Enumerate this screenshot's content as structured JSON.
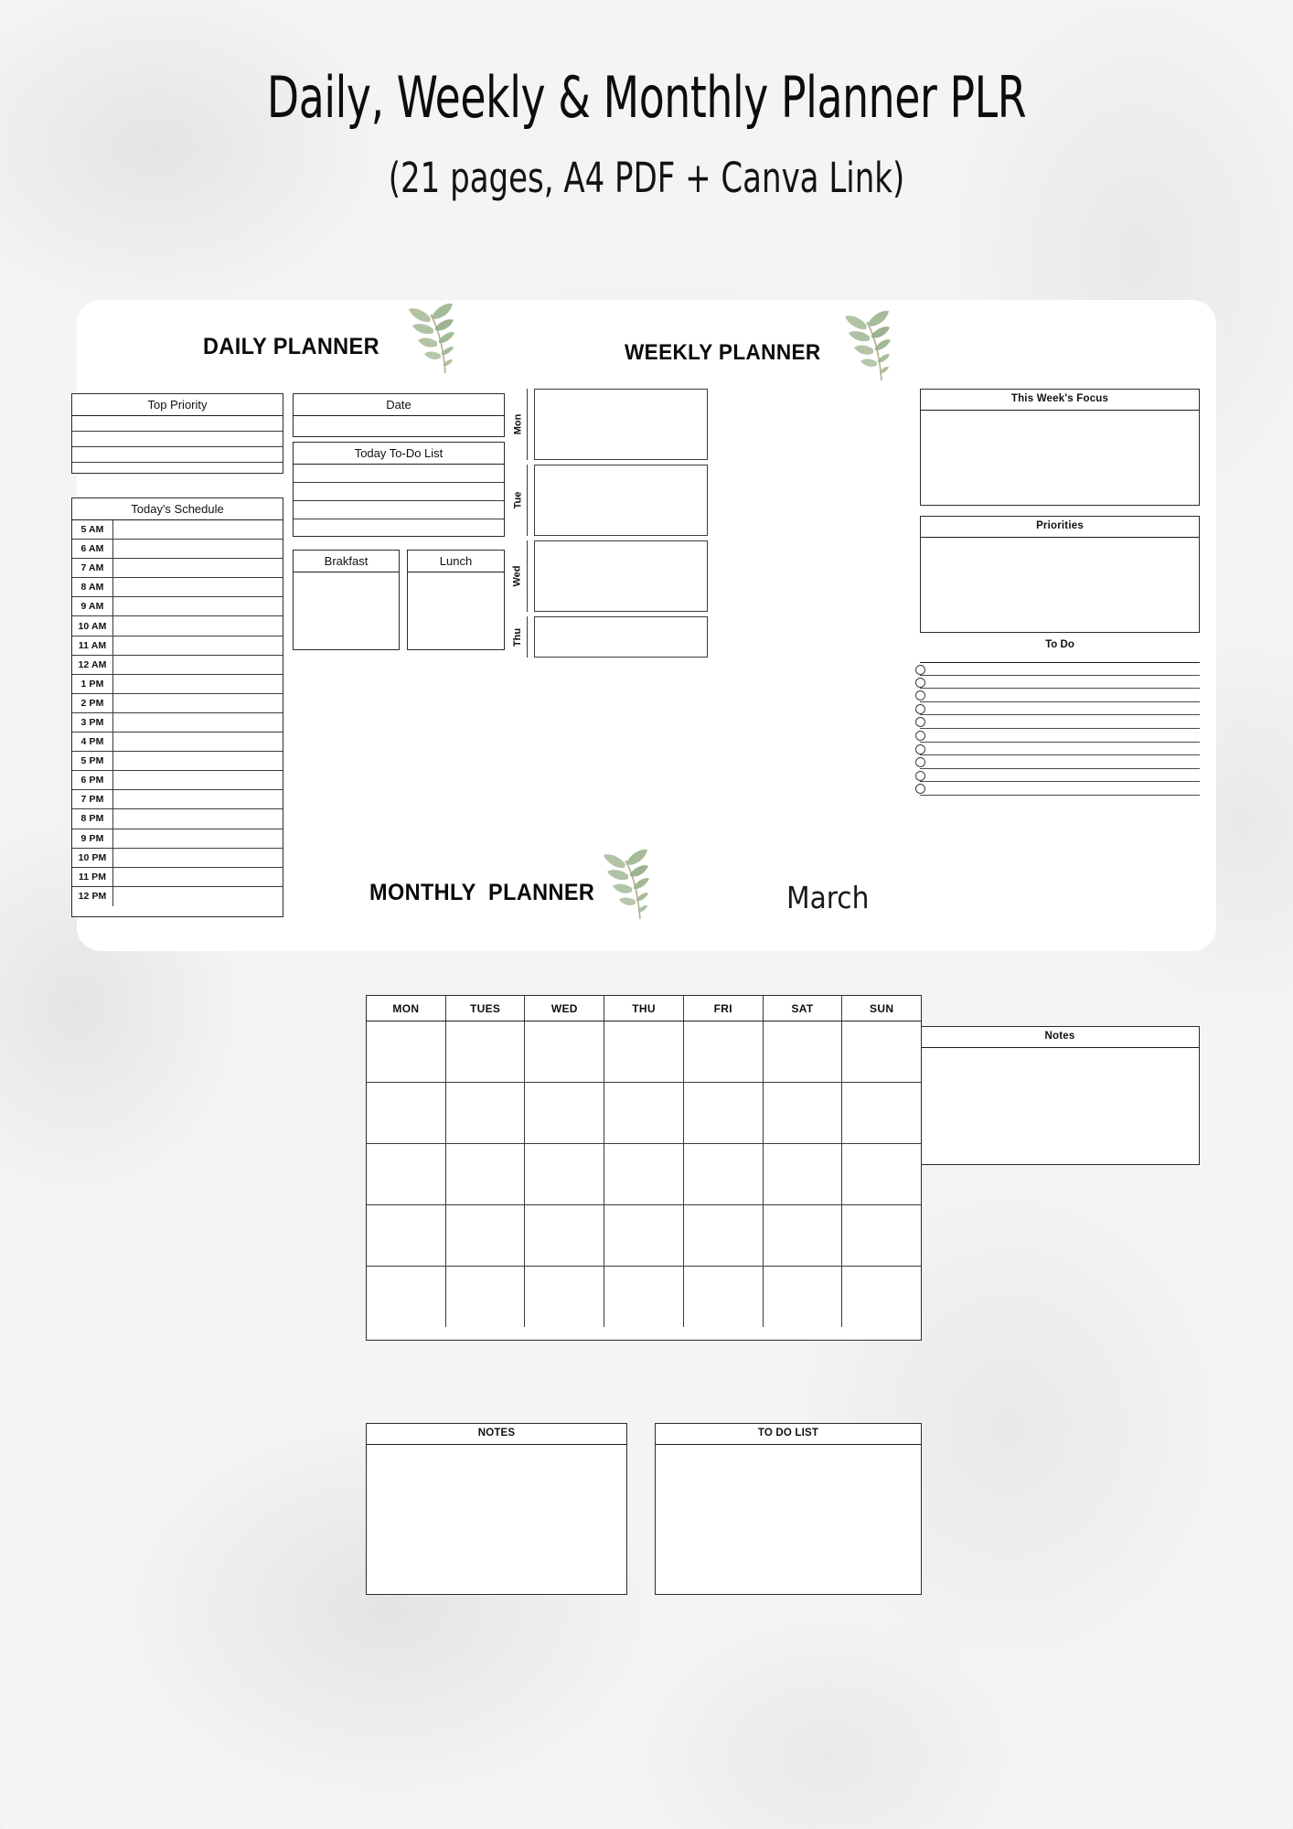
{
  "header": {
    "title": "Daily, Weekly & Monthly Planner PLR",
    "subtitle": "(21 pages, A4 PDF + Canva Link)"
  },
  "colors": {
    "background": "#f4f4f3",
    "card": "#ffffff",
    "ink": "#111111",
    "rule": "#3b3b3b",
    "leaf_green": "#9bb38c",
    "leaf_stem": "#b7ab8a"
  },
  "daily": {
    "wordmark": "DAILY PLANNER",
    "top_priority": {
      "title": "Top Priority",
      "rows": 4
    },
    "schedule": {
      "title": "Today's Schedule",
      "times": [
        "5 AM",
        "6 AM",
        "7 AM",
        "8 AM",
        "9 AM",
        "10 AM",
        "11 AM",
        "12 AM",
        "1 PM",
        "2 PM",
        "3 PM",
        "4 PM",
        "5 PM",
        "6 PM",
        "7 PM",
        "8 PM",
        "9 PM",
        "10 PM",
        "11 PM",
        "12 PM"
      ]
    },
    "date": {
      "title": "Date",
      "rows": 1
    },
    "todo": {
      "title": "Today To-Do List",
      "rows": 4
    },
    "breakfast": {
      "title": "Brakfast"
    },
    "lunch": {
      "title": "Lunch"
    }
  },
  "weekly": {
    "wordmark": "WEEKLY PLANNER",
    "days": [
      "Mon",
      "Tue",
      "Wed",
      "Thu"
    ],
    "focus": {
      "title": "This Week's Focus"
    },
    "priorities": {
      "title": "Priorities"
    },
    "todo": {
      "title": "To Do",
      "lines": 10
    },
    "notes": {
      "title": "Notes"
    }
  },
  "monthly": {
    "wordmark": "MONTHLY  PLANNER",
    "month": "March",
    "day_headers": [
      "MON",
      "TUES",
      "WED",
      "THU",
      "FRI",
      "SAT",
      "SUN"
    ],
    "week_rows": 5,
    "notes": {
      "title": "NOTES"
    },
    "todo": {
      "title": "TO DO LIST"
    }
  },
  "icons": {
    "leaf_sprig": "leaf-sprig-icon",
    "checkbox_circle": "circle-checkbox-icon"
  }
}
